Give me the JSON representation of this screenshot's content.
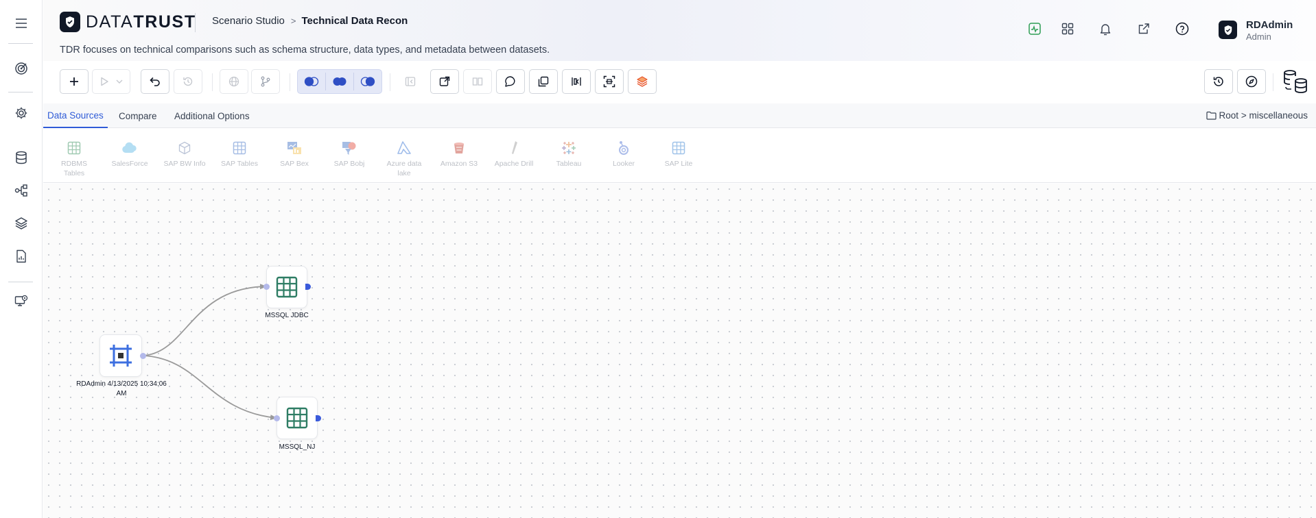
{
  "header": {
    "logo_part1": "DATA",
    "logo_part2": "TRUST",
    "breadcrumb_parent": "Scenario Studio",
    "breadcrumb_current": "Technical Data Recon",
    "subtitle": "TDR focuses on technical comparisons such as schema structure, data types, and metadata between datasets.",
    "user_name": "RDAdmin",
    "user_role": "Admin"
  },
  "tabs": [
    {
      "label": "Data Sources",
      "active": true
    },
    {
      "label": "Compare",
      "active": false
    },
    {
      "label": "Additional Options",
      "active": false
    }
  ],
  "root_path": "Root > miscellaneous",
  "palette": [
    {
      "label": "RDBMS Tables",
      "icon": "table-icon",
      "color": "#2e8b57"
    },
    {
      "label": "SalesForce",
      "icon": "cloud-icon",
      "color": "#1d9bd7"
    },
    {
      "label": "SAP BW Info",
      "icon": "cube-icon",
      "color": "#6b7ea8"
    },
    {
      "label": "SAP Tables",
      "icon": "table-icon",
      "color": "#3b6fc5"
    },
    {
      "label": "SAP Bex",
      "icon": "chart-icon",
      "color": "#3b6fc5"
    },
    {
      "label": "SAP Bobj",
      "icon": "funnel-icon",
      "color": "#e24b3b"
    },
    {
      "label": "Azure data lake",
      "icon": "azure-icon",
      "color": "#2b6cd1"
    },
    {
      "label": "Amazon S3",
      "icon": "bucket-icon",
      "color": "#c1392b"
    },
    {
      "label": "Apache Drill",
      "icon": "drill-icon",
      "color": "#888888"
    },
    {
      "label": "Tableau",
      "icon": "tableau-icon",
      "color": "#e07a2b"
    },
    {
      "label": "Looker",
      "icon": "looker-icon",
      "color": "#4a6fd1"
    },
    {
      "label": "SAP Lite",
      "icon": "table-icon",
      "color": "#2e7bd0"
    }
  ],
  "nodes": [
    {
      "id": "source",
      "label": "RDAdmin 4/13/2025 10:34:06 AM",
      "icon": "frame-icon"
    },
    {
      "id": "jdbc",
      "label": "MSSQL JDBC",
      "icon": "table-icon"
    },
    {
      "id": "nj",
      "label": "MSSQL_NJ",
      "icon": "table-icon"
    }
  ],
  "colors": {
    "accent": "#2f5bd7",
    "table_green": "#2e7d64",
    "port_blue": "#3b5bdb",
    "edge": "#999999"
  }
}
